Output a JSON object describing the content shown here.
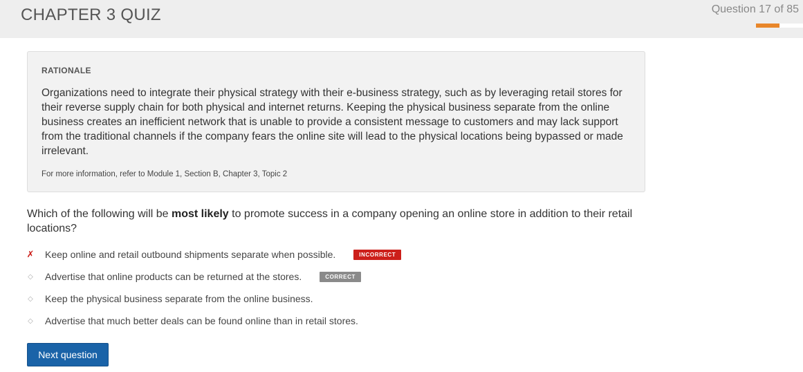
{
  "header": {
    "title": "CHAPTER 3 QUIZ",
    "question_counter": "Question 17 of 85",
    "progress_fraction": 0.5,
    "progress_color": "#e8862a"
  },
  "rationale": {
    "heading": "RATIONALE",
    "body": "Organizations need to integrate their physical strategy with their e-business strategy, such as by leveraging retail stores for their reverse supply chain for both physical and internet returns. Keeping the physical business separate from the online business creates an inefficient network that is unable to provide a consistent message to customers and may lack support from the traditional channels if the company fears the online site will lead to the physical locations being bypassed or made irrelevant.",
    "reference": "For more information, refer to Module 1, Section B, Chapter 3, Topic 2"
  },
  "question": {
    "before": "Which of the following will be ",
    "emphasis": "most likely",
    "after": " to promote success in a company opening an online store in addition to their retail locations?"
  },
  "answers": [
    {
      "text": "Keep online and retail outbound shipments separate when possible.",
      "icon": "x-mark-icon",
      "badge": "INCORRECT"
    },
    {
      "text": "Advertise that online products can be returned at the stores.",
      "icon": "diamond-bullet-icon",
      "badge": "CORRECT"
    },
    {
      "text": "Keep the physical business separate from the online business.",
      "icon": "diamond-bullet-icon",
      "badge": ""
    },
    {
      "text": "Advertise that much better deals can be found online than in retail stores.",
      "icon": "diamond-bullet-icon",
      "badge": ""
    }
  ],
  "next_button": {
    "label": "Next question"
  },
  "colors": {
    "incorrect": "#cc1f1a",
    "correct_badge": "#8a8a8a",
    "primary_button": "#1a63a8"
  }
}
